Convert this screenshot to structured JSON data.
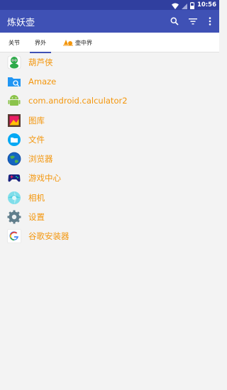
{
  "status_bar": {
    "time": "10:56"
  },
  "app_bar": {
    "title": "炼妖壶"
  },
  "tabs": [
    {
      "label": "关节"
    },
    {
      "label": "界外"
    },
    {
      "label": "壶中界"
    }
  ],
  "apps": [
    {
      "label": "葫芦侠",
      "icon": "huluxia-icon"
    },
    {
      "label": "Amaze",
      "icon": "amaze-folder-icon"
    },
    {
      "label": "com.android.calculator2",
      "icon": "android-icon"
    },
    {
      "label": "图库",
      "icon": "gallery-icon"
    },
    {
      "label": "文件",
      "icon": "files-icon"
    },
    {
      "label": "浏览器",
      "icon": "browser-icon"
    },
    {
      "label": "游戏中心",
      "icon": "gamepad-icon"
    },
    {
      "label": "相机",
      "icon": "camera-icon"
    },
    {
      "label": "设置",
      "icon": "settings-icon"
    },
    {
      "label": "谷歌安装器",
      "icon": "google-icon"
    }
  ],
  "colors": {
    "primary": "#3f51b5",
    "primary_dark": "#303f9f",
    "label": "#f3960c",
    "background": "#f3f3f3"
  }
}
